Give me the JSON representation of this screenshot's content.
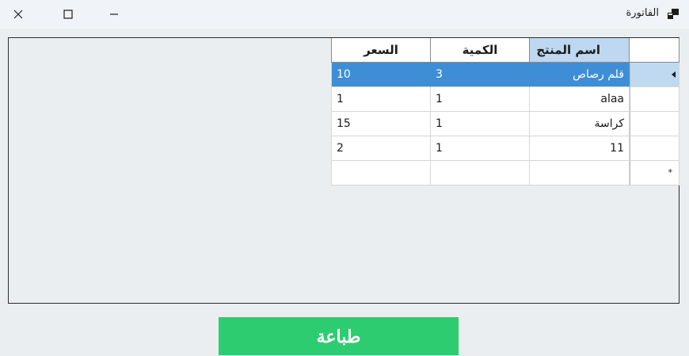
{
  "window": {
    "title": "الفاتورة",
    "icons": {
      "close": "close-icon",
      "maximize": "maximize-icon",
      "minimize": "minimize-icon",
      "app": "app-icon"
    }
  },
  "grid": {
    "columns": [
      "السعر",
      "الكمية",
      "اسم المنتج"
    ],
    "rows": [
      {
        "price": "10",
        "quantity": "3",
        "name": "قلم رصاص",
        "selected": true
      },
      {
        "price": "1",
        "quantity": "1",
        "name": "alaa",
        "selected": false
      },
      {
        "price": "15",
        "quantity": "1",
        "name": "كراسة",
        "selected": false
      },
      {
        "price": "2",
        "quantity": "1",
        "name": "11",
        "selected": false
      }
    ],
    "new_row_marker": "*",
    "colors": {
      "selection": "#3d8ed6",
      "selected_header": "#bdd8f0"
    }
  },
  "print_button": {
    "label": "طباعة",
    "color": "#2ecc71"
  }
}
